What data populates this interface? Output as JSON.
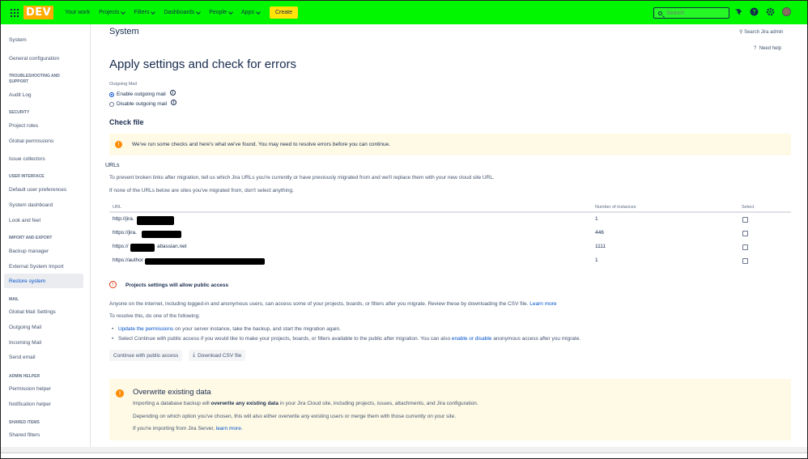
{
  "topbar": {
    "logo": "DEV",
    "nav": [
      "Your work",
      "Projects",
      "Filters",
      "Dashboards",
      "People",
      "Apps"
    ],
    "create": "Create",
    "search_placeholder": "Search",
    "bg_color": "#00f700"
  },
  "sidebar": {
    "items": {
      "system": "System",
      "general_configuration": "General configuration",
      "troubleshooting_head_1": "TROUBLESHOOTING AND",
      "troubleshooting_head_2": "SUPPORT",
      "audit_log": "Audit Log",
      "security_head": "SECURITY",
      "project_roles": "Project roles",
      "global_permissions": "Global permissions",
      "issue_collectors": "Issue collectors",
      "ui_head": "USER INTERFACE",
      "default_user_preferences": "Default user preferences",
      "system_dashboard": "System dashboard",
      "look_and_feel": "Look and feel",
      "import_export_head": "IMPORT AND EXPORT",
      "backup_manager": "Backup manager",
      "external_system_import": "External System Import",
      "restore_system": "Restore system",
      "mail_head": "MAIL",
      "global_mail_settings": "Global Mail Settings",
      "outgoing_mail": "Outgoing Mail",
      "incoming_mail": "Incoming Mail",
      "send_email": "Send email",
      "admin_helper_head": "ADMIN HELPER",
      "permission_helper": "Permission helper",
      "notification_helper": "Notification helper",
      "shared_items_head": "SHARED ITEMS",
      "shared_filters": "Shared filters"
    }
  },
  "main": {
    "page_title": "System",
    "search_admin": "Search Jira admin",
    "need_help": "Need help",
    "heading": "Apply settings and check for errors",
    "outgoing_mail_label": "Outgoing Mail",
    "enable_outgoing": "Enable outgoing mail",
    "disable_outgoing": "Disable outgoing mail",
    "check_file": "Check file",
    "warning": "We've run some checks and here's what we've found. You may need to resolve errors before you can continue.",
    "urls_heading": "URLs",
    "urls_p1": "To prevent broken links after migration, tell us which Jira URLs you're currently or have previously migrated from and we'll replace them with your new cloud site URL.",
    "urls_p2": "If none of the URLs below are sites you've migrated from, don't select anything.",
    "table": {
      "headers": [
        "URL",
        "Number of instances",
        "Select"
      ],
      "rows": [
        {
          "url": "http://jira.",
          "count": "1"
        },
        {
          "url": "https://jira.",
          "count": "446"
        },
        {
          "url": "https://",
          "url_suffix": "atlassian.net",
          "count": "1111"
        },
        {
          "url": "https://author",
          "count": "1"
        }
      ]
    },
    "public_access_title": "Projects settings will allow public access",
    "public_p1": "Anyone on the internet, including logged-in and anonymous users, can access some of your projects, boards, or filters after you migrate. Review these by downloading the CSV file.",
    "learn_more": "Learn more",
    "resolve_intro": "To resolve this, do one of the following:",
    "bullet1_link": "Update the permissions",
    "bullet1_text": " on your server instance, take the backup, and start the migration again.",
    "bullet2_text": "Select Continue with public access if you would like to make your projects, boards, or filters available to the public after migration. You can also ",
    "bullet2_link": "enable or disable",
    "bullet2_tail": " anonymous access after you migrate.",
    "continue_btn": "Continue with public access",
    "download_btn": "Download CSV file",
    "overwrite_title": "Overwrite existing data",
    "ow_p1_a": "Importing a database backup will ",
    "ow_p1_b": "overwrite any existing data",
    "ow_p1_c": " in your Jira Cloud site, including projects, issues, attachments, and Jira configuration.",
    "ow_p2": "Depending on which option you've chosen, this will also either overwrite any existing users or merge them with those currently on your site.",
    "ow_p3": "If you're importing from Jira Server, ",
    "ow_p3_link": "learn more."
  }
}
